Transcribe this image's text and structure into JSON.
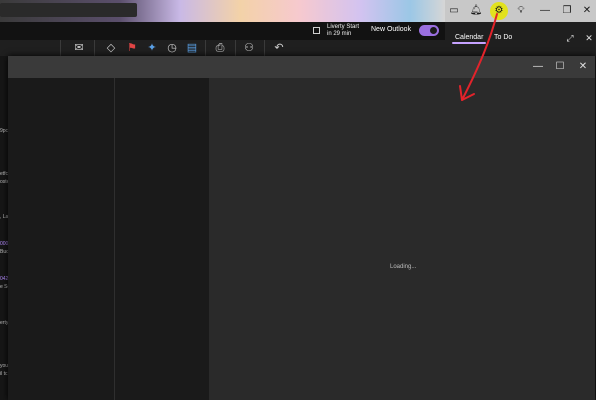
{
  "header": {
    "reminder": {
      "title": "Liverty Start",
      "subtitle": "in 29 min"
    },
    "new_outlook_label": "New Outlook",
    "new_outlook_toggle_on": true
  },
  "right_panel": {
    "tabs": [
      {
        "label": "Calendar",
        "selected": true
      },
      {
        "label": "To Do",
        "selected": false
      }
    ]
  },
  "dialog": {
    "loading_text": "Loading..."
  },
  "left_fragments": [
    {
      "text": "9pc"
    },
    {
      "text": "etfc"
    },
    {
      "text": "oste"
    },
    {
      "text": ", La"
    },
    {
      "text": "000"
    },
    {
      "text": "Buc"
    },
    {
      "text": "042"
    },
    {
      "text": "e Sc"
    },
    {
      "text": "erty"
    },
    {
      "text": "you"
    },
    {
      "text": "il tc"
    }
  ],
  "colors": {
    "toggle_on": "#9a6fe0",
    "calendar_tab_underline": "#c6a2ff",
    "annotation_arrow": "#e3232b",
    "highlight_circle": "#e6e600"
  }
}
